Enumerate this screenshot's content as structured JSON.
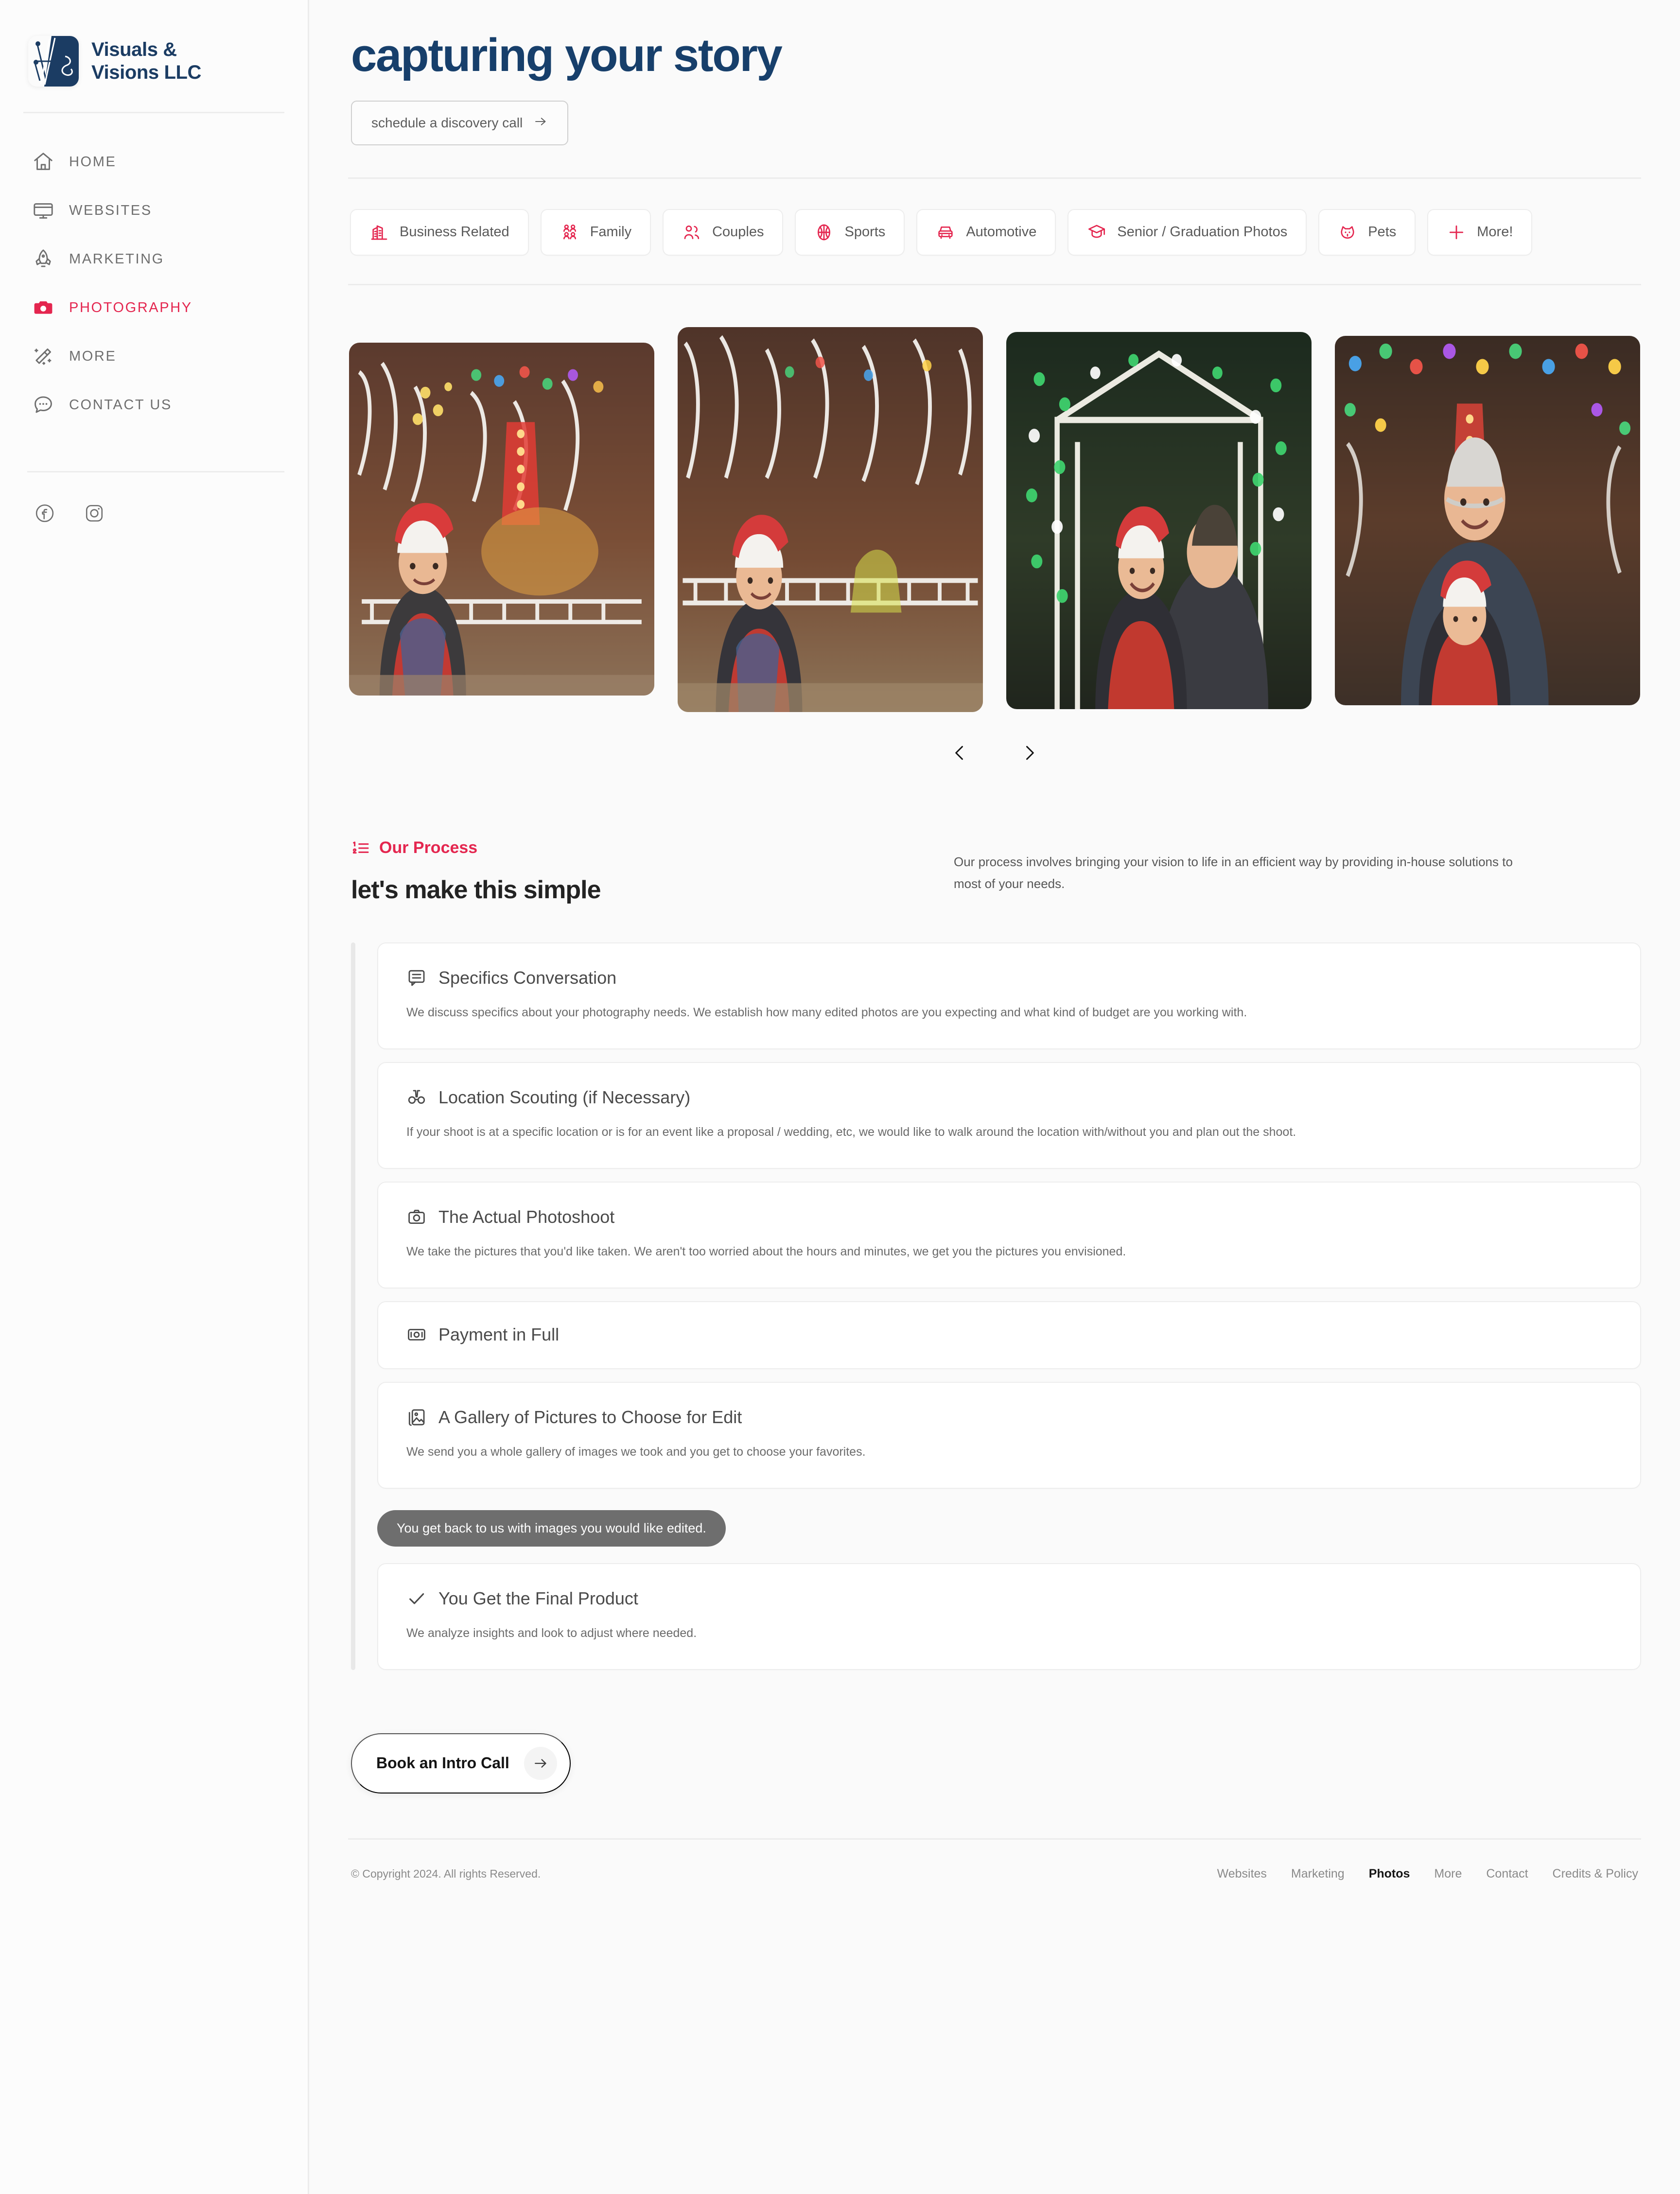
{
  "brand": {
    "name": "Visuals &\nVisions LLC",
    "mark_icon": "vv-monogram-logo",
    "accent": "#1b3c63"
  },
  "sidebar": {
    "items": [
      {
        "label": "HOME",
        "icon": "home-icon",
        "active": false
      },
      {
        "label": "WEBSITES",
        "icon": "monitor-icon",
        "active": false
      },
      {
        "label": "MARKETING",
        "icon": "rocket-icon",
        "active": false
      },
      {
        "label": "PHOTOGRAPHY",
        "icon": "camera-icon",
        "active": true
      },
      {
        "label": "MORE",
        "icon": "magic-wand-icon",
        "active": false
      },
      {
        "label": "CONTACT US",
        "icon": "chat-bubble-icon",
        "active": false
      }
    ],
    "socials": [
      {
        "name": "facebook-icon"
      },
      {
        "name": "instagram-icon"
      }
    ],
    "active_color": "#e4264f"
  },
  "hero": {
    "title": "capturing your story",
    "cta_label": "schedule a discovery call",
    "cta_arrow": "arrow-right-icon"
  },
  "categories": [
    {
      "label": "Business Related",
      "icon": "building-icon"
    },
    {
      "label": "Family",
      "icon": "family-group-icon"
    },
    {
      "label": "Couples",
      "icon": "couple-icon"
    },
    {
      "label": "Sports",
      "icon": "basketball-icon"
    },
    {
      "label": "Automotive",
      "icon": "car-icon"
    },
    {
      "label": "Senior / Graduation Photos",
      "icon": "graduation-cap-icon"
    },
    {
      "label": "Pets",
      "icon": "dog-icon"
    },
    {
      "label": "More!",
      "icon": "plus-icon"
    }
  ],
  "gallery": {
    "items": [
      {
        "alt": "Boy in santa hat seated among white christmas light sculptures"
      },
      {
        "alt": "Boy in santa hat sitting on rock by lit railing and light displays"
      },
      {
        "alt": "Father and child under an archway of green and white christmas lights"
      },
      {
        "alt": "Man and child in santa hat with colorful bokeh lights behind them"
      }
    ],
    "prev_icon": "chevron-left-icon",
    "next_icon": "chevron-right-icon"
  },
  "process": {
    "eyebrow": "Our Process",
    "eyebrow_icon": "ordered-list-icon",
    "title": "let's make this simple",
    "description": "Our process involves bringing your vision to life in an efficient way  by providing in-house solutions to most of your needs.",
    "steps": [
      {
        "icon": "message-lines-icon",
        "title": "Specifics Conversation",
        "desc": "We discuss specifics about  your photography needs. We establish how many edited photos are you expecting and what kind of budget are you working with."
      },
      {
        "icon": "binoculars-icon",
        "title": "Location Scouting (if Necessary)",
        "desc": "If your shoot is at a specific location or is for an event like a proposal / wedding, etc, we would like to walk around the location with/without you and plan out the shoot."
      },
      {
        "icon": "camera-outline-icon",
        "title": "The Actual Photoshoot",
        "desc": "We take the pictures that you'd like taken. We aren't too worried about the hours and minutes, we get you the pictures you envisioned."
      },
      {
        "icon": "money-bill-icon",
        "title": "Payment in Full",
        "desc": ""
      },
      {
        "icon": "image-gallery-icon",
        "title": "A Gallery of Pictures to Choose for Edit",
        "desc": "We send you a whole gallery of images we took and you get to choose your favorites."
      }
    ],
    "pill": "You get back to us with images you would like edited.",
    "final_step": {
      "icon": "check-icon",
      "title": "You Get the Final Product",
      "desc": "We analyze insights and look to adjust where needed."
    }
  },
  "intro_cta": {
    "label": "Book an Intro Call",
    "arrow": "arrow-right-icon"
  },
  "footer": {
    "copyright": "© Copyright 2024. All rights Reserved.",
    "links": [
      {
        "label": "Websites",
        "current": false
      },
      {
        "label": "Marketing",
        "current": false
      },
      {
        "label": "Photos",
        "current": true
      },
      {
        "label": "More",
        "current": false
      },
      {
        "label": "Contact",
        "current": false
      },
      {
        "label": "Credits & Policy",
        "current": false
      }
    ]
  }
}
